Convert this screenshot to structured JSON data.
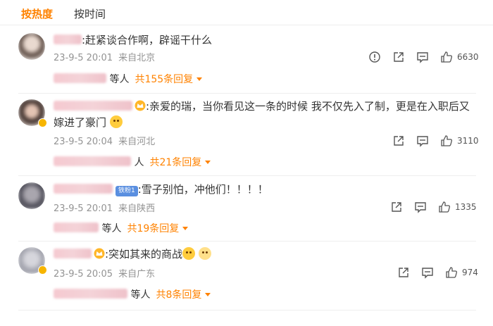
{
  "tabs": {
    "hot": "按热度",
    "time": "按时间"
  },
  "comments": [
    {
      "text": ":赶紧谈合作啊，辟谣干什么",
      "time": "23-9-5 20:01",
      "location": "来自北京",
      "likes": "6630",
      "reply_prefix": "等人",
      "reply_link": "共155条回复"
    },
    {
      "text_line1": ":亲爱的瑞，当你看见这一条的时候 我不仅先入了制，更是在入职后又",
      "text_line2": "嫁进了豪门",
      "time": "23-9-5 20:04",
      "location": "来自河北",
      "likes": "3110",
      "reply_prefix": "人",
      "reply_link": "共21条回复"
    },
    {
      "badge": "铁粉1",
      "text": ":雪子别怕，冲他们！！！！",
      "time": "23-9-5 20:01",
      "location": "来自陕西",
      "likes": "1335",
      "reply_prefix": "等人",
      "reply_link": "共19条回复"
    },
    {
      "text": ":突如其来的商战",
      "time": "23-9-5 20:05",
      "location": "来自广东",
      "likes": "974",
      "reply_prefix": "等人",
      "reply_link": "共8条回复"
    }
  ],
  "colors": {
    "accent": "#ff8200",
    "meta": "#939393",
    "badge": "#5a8fe0"
  },
  "icons": [
    "report-icon",
    "share-icon",
    "comment-icon",
    "like-icon"
  ]
}
